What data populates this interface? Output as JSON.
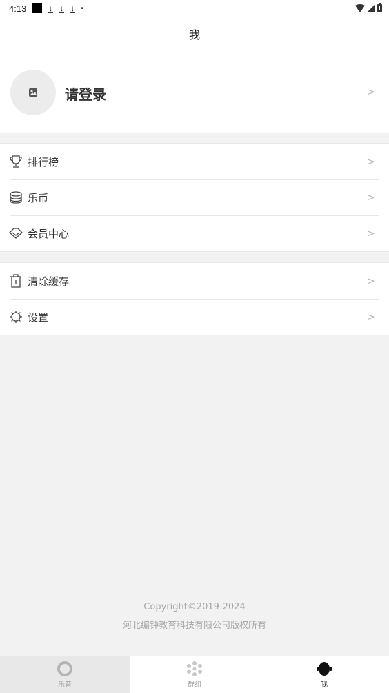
{
  "status_bar": {
    "time": "4:13",
    "icons": [
      "notification-square-icon",
      "download-icon",
      "download-icon",
      "download-icon",
      "dot-icon",
      "wifi-icon",
      "signal-icon",
      "battery-icon"
    ]
  },
  "header": {
    "title": "我"
  },
  "profile": {
    "login_label": "请登录",
    "avatar_icon": "image-placeholder-icon"
  },
  "menu_group_1": [
    {
      "label": "排行榜",
      "icon": "trophy-icon"
    },
    {
      "label": "乐币",
      "icon": "coins-icon"
    },
    {
      "label": "会员中心",
      "icon": "diamond-icon"
    }
  ],
  "menu_group_2": [
    {
      "label": "清除缓存",
      "icon": "trash-icon"
    },
    {
      "label": "设置",
      "icon": "gear-icon"
    }
  ],
  "footer": {
    "copyright": "Copyright©2019-2024",
    "company": "河北编钟教育科技有限公司版权所有"
  },
  "tabs": [
    {
      "label": "乐音",
      "icon": "music-ring-icon"
    },
    {
      "label": "群组",
      "icon": "cluster-icon"
    },
    {
      "label": "我",
      "icon": "bell-me-icon"
    }
  ],
  "colors": {
    "accent": "#222222",
    "background": "#f2f2f2",
    "muted": "#a6a6a6"
  }
}
